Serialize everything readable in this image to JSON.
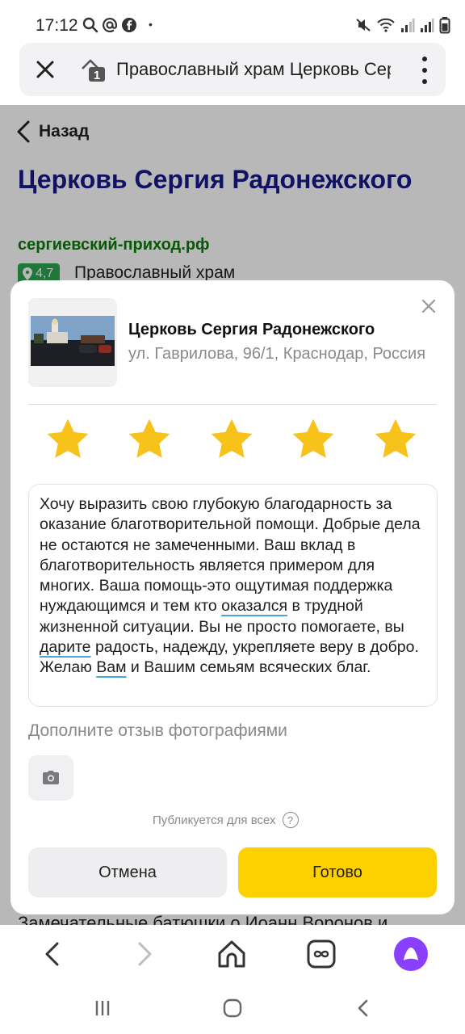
{
  "status_bar": {
    "time": "17:12",
    "left_icons": [
      "search-icon",
      "at-icon",
      "facebook-icon"
    ],
    "dot": "•",
    "right_icons": [
      "mute-icon",
      "wifi-icon",
      "signal-icon",
      "signal-icon",
      "battery-icon"
    ]
  },
  "browser": {
    "tab_count": "1",
    "page_title": "Православный храм Церковь Сергия Радонежского"
  },
  "page": {
    "back_label": "Назад",
    "title": "Церковь Сергия Радонежского",
    "url": "сергиевский-приход.рф",
    "rating": "4,7",
    "category": "Православный храм",
    "bottom_text": "Замечательные батюшки о.Иоанн Воронов и"
  },
  "review_dialog": {
    "place_name": "Церковь Сергия Радонежского",
    "place_address": "ул. Гаврилова, 96/1, Краснодар, Россия",
    "stars_selected": 5,
    "stars_total": 5,
    "review_parts": [
      "Хочу выразить свою глубокую благодарность за оказание благотворительной помощи. Добрые дела не остаются не замеченными. Ваш вклад в благотворительность является примером для многих. Ваша помощь-это ощутимая поддержка нуждающимся и тем кто ",
      "оказался",
      " в трудной жизненной ситуации. Вы не просто помогаете, вы ",
      "дарите",
      " радость, надежду, укрепляете веру в добро. Желаю ",
      "Вам",
      " и Вашим семьям всяческих благ."
    ],
    "photos_label": "Дополните отзыв фотографиями",
    "publish_note": "Публикуется для всех",
    "help_symbol": "?",
    "cancel_label": "Отмена",
    "done_label": "Готово"
  },
  "colors": {
    "title": "#1a1a8c",
    "url": "#0b7a0b",
    "rating_badge": "#2fa44f",
    "star": "#f7c21a",
    "done_button": "#fdd000",
    "alice": "#8a3ffc"
  }
}
